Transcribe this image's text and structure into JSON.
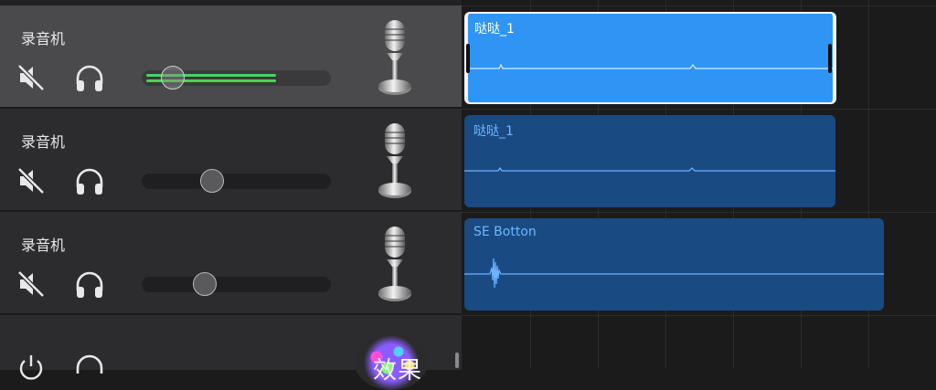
{
  "tracks": [
    {
      "name": "录音机",
      "volume": 0.16,
      "level": 0.7,
      "selected": true,
      "mute_icon": "speaker-muted-icon",
      "headphone_icon": "headphones-icon",
      "instrument_icon": "microphone-icon"
    },
    {
      "name": "录音机",
      "volume": 0.38,
      "selected": false,
      "mute_icon": "speaker-muted-icon",
      "headphone_icon": "headphones-icon",
      "instrument_icon": "microphone-icon"
    },
    {
      "name": "录音机",
      "volume": 0.34,
      "selected": false,
      "mute_icon": "speaker-muted-icon",
      "headphone_icon": "headphones-icon",
      "instrument_icon": "microphone-icon"
    }
  ],
  "fx_track": {
    "label": "效果",
    "power_icon": "power-icon",
    "headphone_icon": "headphones-icon"
  },
  "regions": [
    {
      "name": "哒哒_1",
      "selected": true
    },
    {
      "name": "哒哒_1",
      "selected": false
    },
    {
      "name": "SE Botton",
      "selected": false
    }
  ],
  "colors": {
    "selected_region": "#2f95f5",
    "region": "#194a82",
    "level_meter": "#4bd35a"
  }
}
